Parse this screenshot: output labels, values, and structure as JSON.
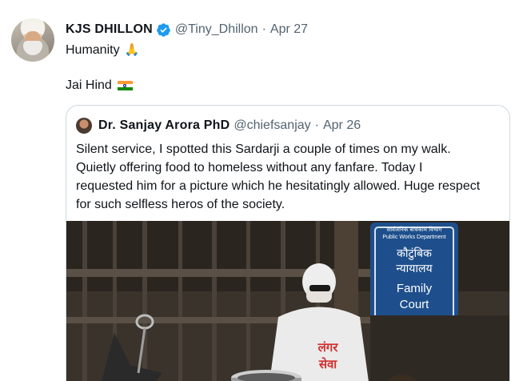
{
  "tweet": {
    "display_name": "KJS DHILLON",
    "handle": "@Tiny_Dhillon",
    "separator": "·",
    "date": "Apr 27",
    "lines": [
      "Humanity",
      "",
      "Jai Hind"
    ],
    "emoji_praying": "🙏",
    "flag_icon": "india-flag-icon"
  },
  "quote": {
    "display_name": "Dr. Sanjay Arora PhD",
    "handle": "@chiefsanjay",
    "separator": "·",
    "date": "Apr 26",
    "text_lines": [
      "Silent service, I spotted this Sardarji a couple of times on my walk.",
      "Quietly offering food to homeless without any fanfare. Today I",
      "requested him for a picture which he hesitatingly allowed. Huge respect",
      "for such selfless heros of the society."
    ],
    "photo": {
      "sign_lines": [
        "सार्वजनिक बांधकाम विभाग",
        "Public Works Department",
        "कौटुंबिक",
        "न्यायालय",
        "Family",
        "Court"
      ],
      "shirt_text": [
        "लंगर",
        "सेवा"
      ]
    }
  },
  "colors": {
    "text": "#0f1419",
    "secondary": "#536471",
    "border": "#cfd9de",
    "verified": "#1d9bf0",
    "sign_blue": "#1e4f8c"
  }
}
